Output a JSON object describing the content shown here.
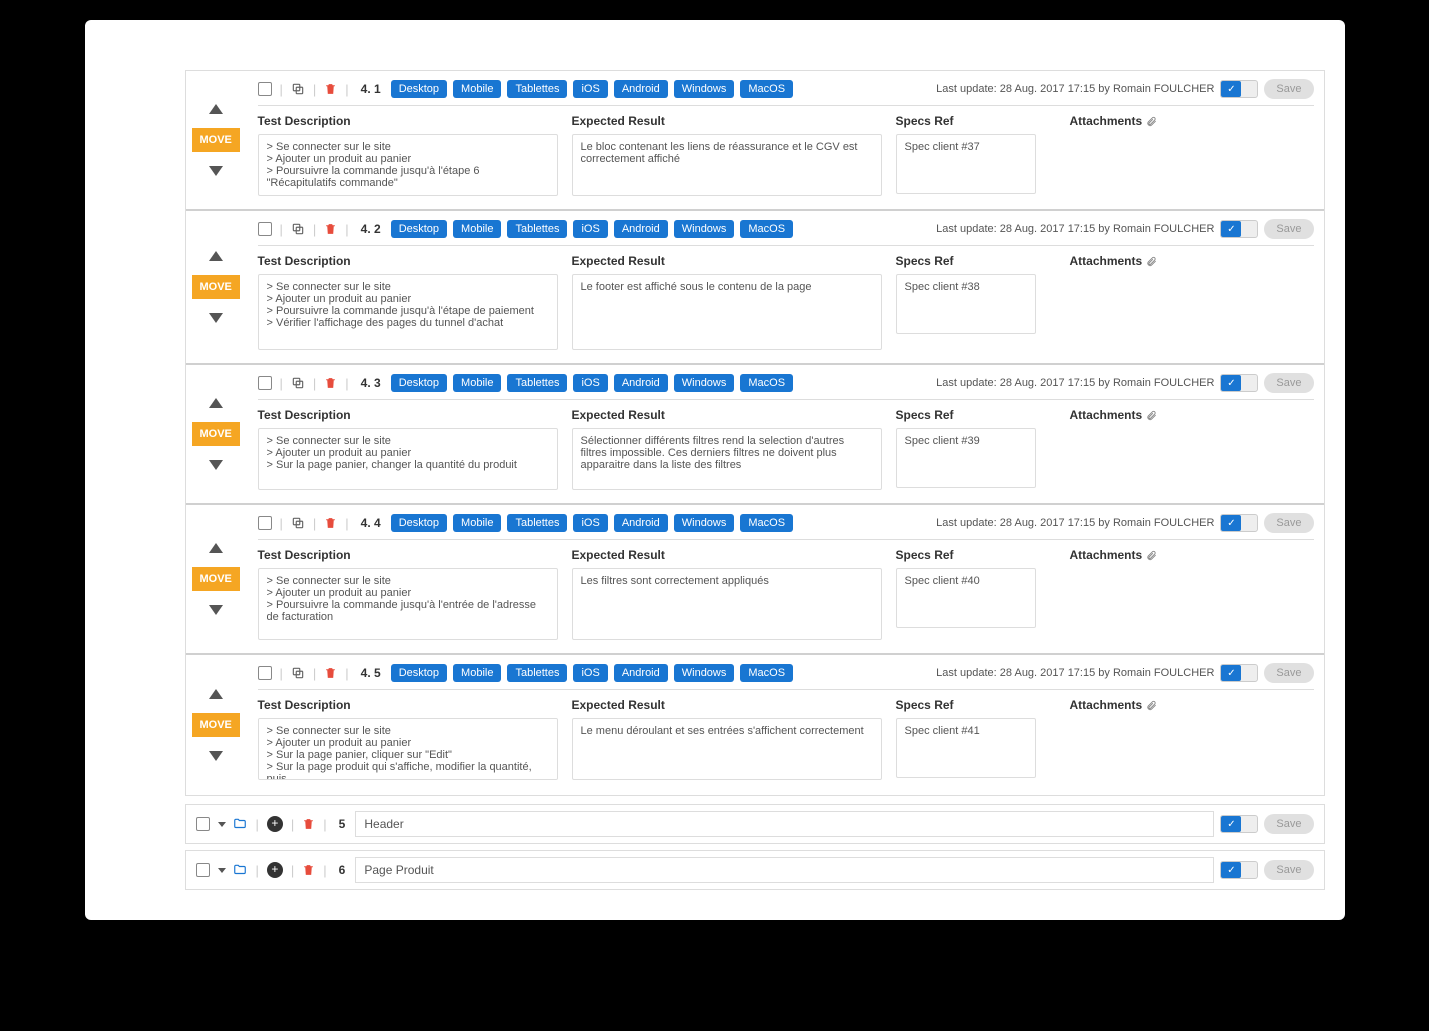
{
  "labels": {
    "move": "MOVE",
    "save": "Save",
    "testDescription": "Test Description",
    "expectedResult": "Expected Result",
    "specsRef": "Specs Ref",
    "attachments": "Attachments"
  },
  "tags": [
    "Desktop",
    "Mobile",
    "Tablettes",
    "iOS",
    "Android",
    "Windows",
    "MacOS"
  ],
  "lastUpdatePrefix": "Last update:",
  "lastUpdateValue": "28 Aug. 2017 17:15 by Romain FOULCHER",
  "testcases": [
    {
      "id": "4. 1",
      "desc": "> Se connecter sur le site\n> Ajouter un produit au panier\n> Poursuivre la commande jusqu'à l'étape 6 \"Récapitulatifs commande\"",
      "expected": "Le bloc contenant les liens de réassurance et le CGV est correctement affiché",
      "spec": "Spec client #37"
    },
    {
      "id": "4. 2",
      "desc": "> Se connecter sur le site\n> Ajouter un produit au panier\n> Poursuivre la commande jusqu'à l'étape de paiement\n> Vérifier l'affichage des pages du tunnel d'achat",
      "expected": "Le footer est affiché sous le contenu de la page",
      "spec": "Spec client #38"
    },
    {
      "id": "4. 3",
      "desc": "> Se connecter sur le site\n> Ajouter un produit au panier\n> Sur la page panier, changer la quantité du produit",
      "expected": "Sélectionner différents filtres rend la selection d'autres filtres impossible. Ces derniers filtres ne doivent plus apparaitre dans la liste des filtres",
      "spec": "Spec client #39"
    },
    {
      "id": "4. 4",
      "desc": "> Se connecter sur le site\n> Ajouter un produit au panier\n> Poursuivre la commande jusqu'à l'entrée de l'adresse de facturation",
      "expected": "Les filtres sont correctement appliqués",
      "spec": "Spec client #40"
    },
    {
      "id": "4. 5",
      "desc": "> Se connecter sur le site\n> Ajouter un produit au panier\n> Sur la page panier, cliquer sur \"Edit\"\n> Sur la page produit qui s'affiche, modifier la quantité, puis",
      "expected": "Le menu déroulant et ses entrées s'affichent correctement",
      "spec": "Spec client #41"
    }
  ],
  "sections": [
    {
      "id": "5",
      "title": "Header"
    },
    {
      "id": "6",
      "title": "Page Produit"
    }
  ]
}
